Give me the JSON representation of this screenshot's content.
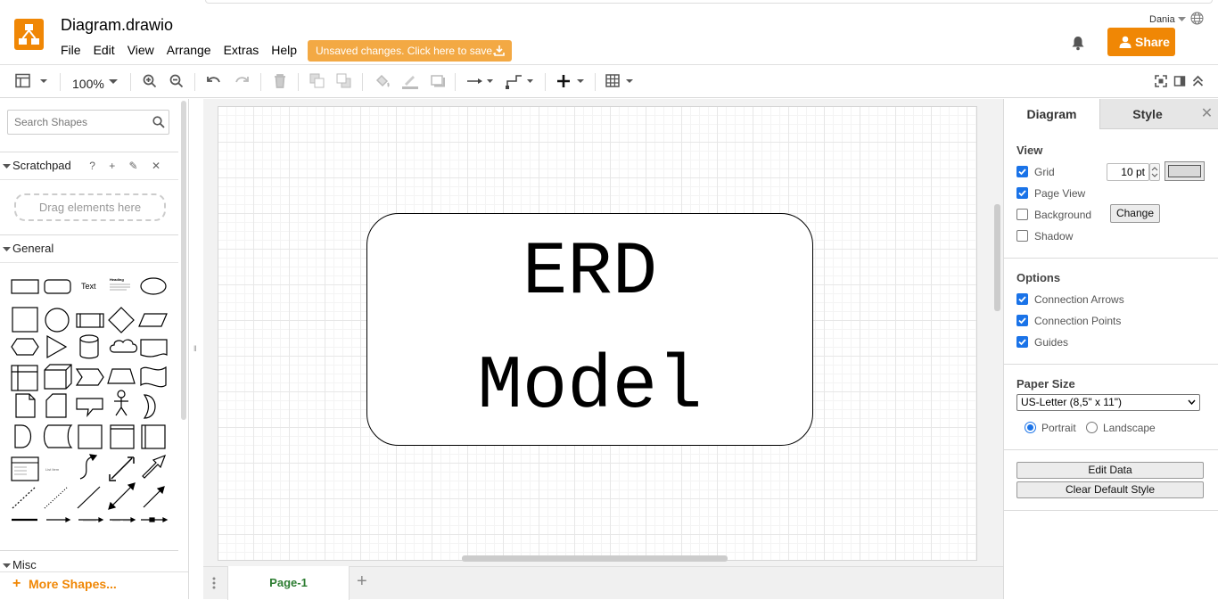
{
  "app": {
    "title": "Diagram.drawio",
    "menu": [
      "File",
      "Edit",
      "View",
      "Arrange",
      "Extras",
      "Help"
    ],
    "save_banner": "Unsaved changes. Click here to save.",
    "user": "Dania",
    "share_label": "Share"
  },
  "toolbar": {
    "zoom": "100%",
    "icons": [
      "format-panel-icon",
      "zoom-in-icon",
      "zoom-out-icon",
      "undo-icon",
      "redo-icon",
      "delete-icon",
      "to-front-icon",
      "to-back-icon",
      "fill-color-icon",
      "line-color-icon",
      "shadow-icon",
      "connection-icon",
      "waypoints-icon",
      "insert-icon",
      "table-icon",
      "fullscreen-icon",
      "format-icon",
      "collapse-icon"
    ]
  },
  "left_panel": {
    "search_placeholder": "Search Shapes",
    "scratchpad": "Scratchpad",
    "scratchpad_tools": "? + ✎ ✕",
    "drag_hint": "Drag elements here",
    "general": "General",
    "misc": "Misc",
    "more_shapes": "More Shapes...",
    "shape_text_label": "Text",
    "shape_heading_label": "Heading",
    "shape_list_label": "List Item"
  },
  "canvas": {
    "shape_line1": "ERD",
    "shape_line2": "Model"
  },
  "pages": {
    "active": "Page-1",
    "menu_icon": "⋮",
    "add": "+"
  },
  "right_panel": {
    "tabs": [
      "Diagram",
      "Style"
    ],
    "close": "✕",
    "view_title": "View",
    "view_options": [
      {
        "label": "Grid",
        "checked": true
      },
      {
        "label": "Page View",
        "checked": true
      },
      {
        "label": "Background",
        "checked": false
      },
      {
        "label": "Shadow",
        "checked": false
      }
    ],
    "grid_size": "10 pt",
    "grid_color": "#d9d9d9",
    "change_button": "Change",
    "options_title": "Options",
    "options": [
      {
        "label": "Connection Arrows",
        "checked": true
      },
      {
        "label": "Connection Points",
        "checked": true
      },
      {
        "label": "Guides",
        "checked": true
      }
    ],
    "paper_title": "Paper Size",
    "paper_size": "US-Letter (8,5\" x 11\")",
    "orientation": {
      "portrait": "Portrait",
      "landscape": "Landscape",
      "selected": "Portrait"
    },
    "edit_data": "Edit Data",
    "clear_style": "Clear Default Style"
  },
  "colors": {
    "accent": "#f08705",
    "banner": "#f3a944",
    "check": "#1a73e8",
    "page_tab_text": "#2d7d32"
  }
}
